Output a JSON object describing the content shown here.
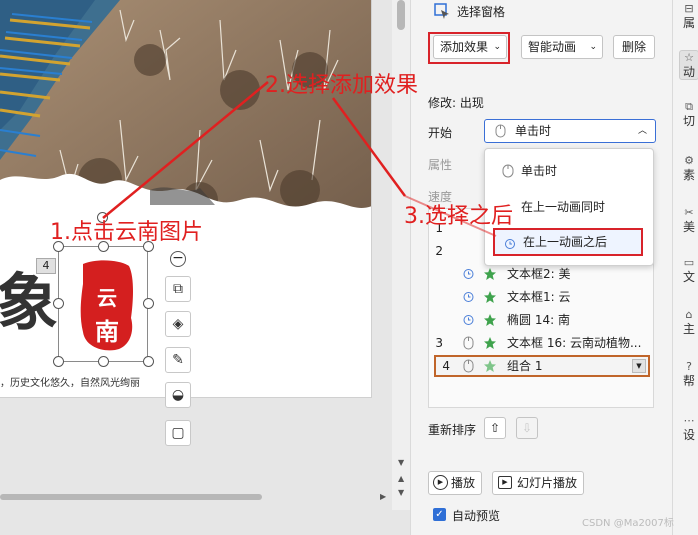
{
  "pane": {
    "title": "选择窗格",
    "add_effect": "添加效果",
    "smart_animation": "智能动画",
    "delete": "删除",
    "modify_label": "修改: 出现",
    "start_label": "开始",
    "start_value": "单击时",
    "property_label": "属性",
    "speed_label": "速度",
    "reorder_label": "重新排序",
    "play": "播放",
    "slideshow": "幻灯片播放",
    "autopreview": "自动预览"
  },
  "dropdown": {
    "items": [
      "单击时",
      "在上一动画同时",
      "在上一动画之后"
    ],
    "selected_index": 2
  },
  "anim_list": {
    "rows": [
      {
        "num": "1",
        "name": ""
      },
      {
        "num": "2",
        "name": ""
      },
      {
        "num": "",
        "name": "文本框2: 美"
      },
      {
        "num": "",
        "name": "文本框1: 云"
      },
      {
        "num": "",
        "name": "椭圆 14: 南"
      },
      {
        "num": "3",
        "name": "文本框 16: 云南动植物..."
      },
      {
        "num": "4",
        "name": "组合 1"
      }
    ]
  },
  "slide": {
    "big_char": "象",
    "seal_top": "云",
    "seal_bottom": "南",
    "tagline": "，历史文化悠久，自然风光绚丽",
    "group_number": "4"
  },
  "right_strip": {
    "items": [
      "属",
      "动",
      "切",
      "素",
      "美",
      "文",
      "主",
      "帮",
      "设"
    ]
  },
  "annotations": {
    "step1": "1.点击云南图片",
    "step2": "2.选择添加效果",
    "step3": "3.选择之后"
  },
  "watermark": "CSDN @Ma2007标",
  "colors": {
    "annotation_red": "#e02020",
    "accent_blue": "#3a6fd6",
    "selected_row_border": "#c0652a",
    "seal_red": "#d41f1f"
  }
}
